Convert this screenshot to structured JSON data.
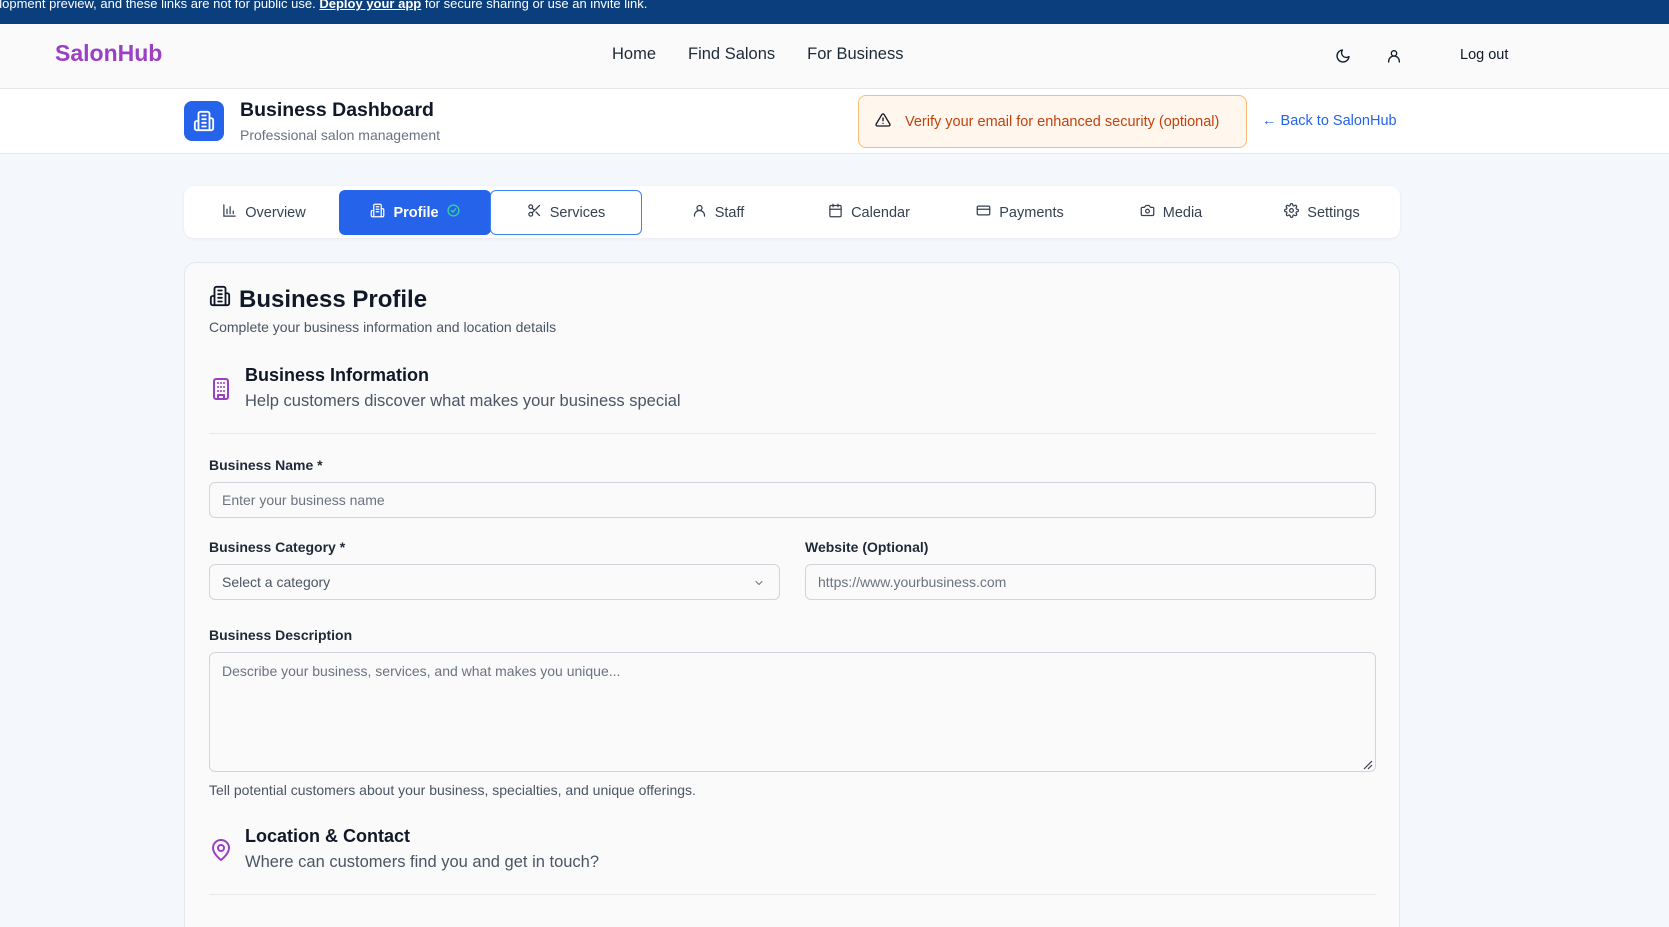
{
  "banner": {
    "text_before": "elopment preview, and these links are not for public use. ",
    "link": "Deploy your app",
    "text_after": " for secure sharing or use an invite link."
  },
  "nav": {
    "brand": "SalonHub",
    "links": [
      "Home",
      "Find Salons",
      "For Business"
    ],
    "logout": "Log out"
  },
  "dashboard": {
    "title": "Business Dashboard",
    "subtitle": "Professional salon management",
    "verify_notice": "Verify your email for enhanced security (optional)",
    "back_link": "← Back to SalonHub"
  },
  "tabs": [
    {
      "label": "Overview",
      "icon": "bar-chart-icon"
    },
    {
      "label": "Profile",
      "icon": "building-icon",
      "active": true,
      "status_icon": "check-circle-icon"
    },
    {
      "label": "Services",
      "icon": "scissors-icon"
    },
    {
      "label": "Staff",
      "icon": "user-icon"
    },
    {
      "label": "Calendar",
      "icon": "calendar-icon"
    },
    {
      "label": "Payments",
      "icon": "credit-card-icon"
    },
    {
      "label": "Media",
      "icon": "camera-icon"
    },
    {
      "label": "Settings",
      "icon": "gear-icon"
    }
  ],
  "profile": {
    "title": "Business Profile",
    "subtitle": "Complete your business information and location details",
    "business_info": {
      "title": "Business Information",
      "subtitle": "Help customers discover what makes your business special"
    },
    "business_name": {
      "label": "Business Name *",
      "placeholder": "Enter your business name"
    },
    "category": {
      "label": "Business Category *",
      "placeholder": "Select a category"
    },
    "website": {
      "label": "Website (Optional)",
      "placeholder": "https://www.yourbusiness.com"
    },
    "description": {
      "label": "Business Description",
      "placeholder": "Describe your business, services, and what makes you unique...",
      "help": "Tell potential customers about your business, specialties, and unique offerings."
    },
    "location": {
      "title": "Location & Contact",
      "subtitle": "Where can customers find you and get in touch?"
    }
  },
  "colors": {
    "brand": "#9b3fc4",
    "primary": "#2563eb",
    "banner": "#0b3e7c",
    "warning_bg": "#fff7ed",
    "warning_text": "#c2410c"
  }
}
